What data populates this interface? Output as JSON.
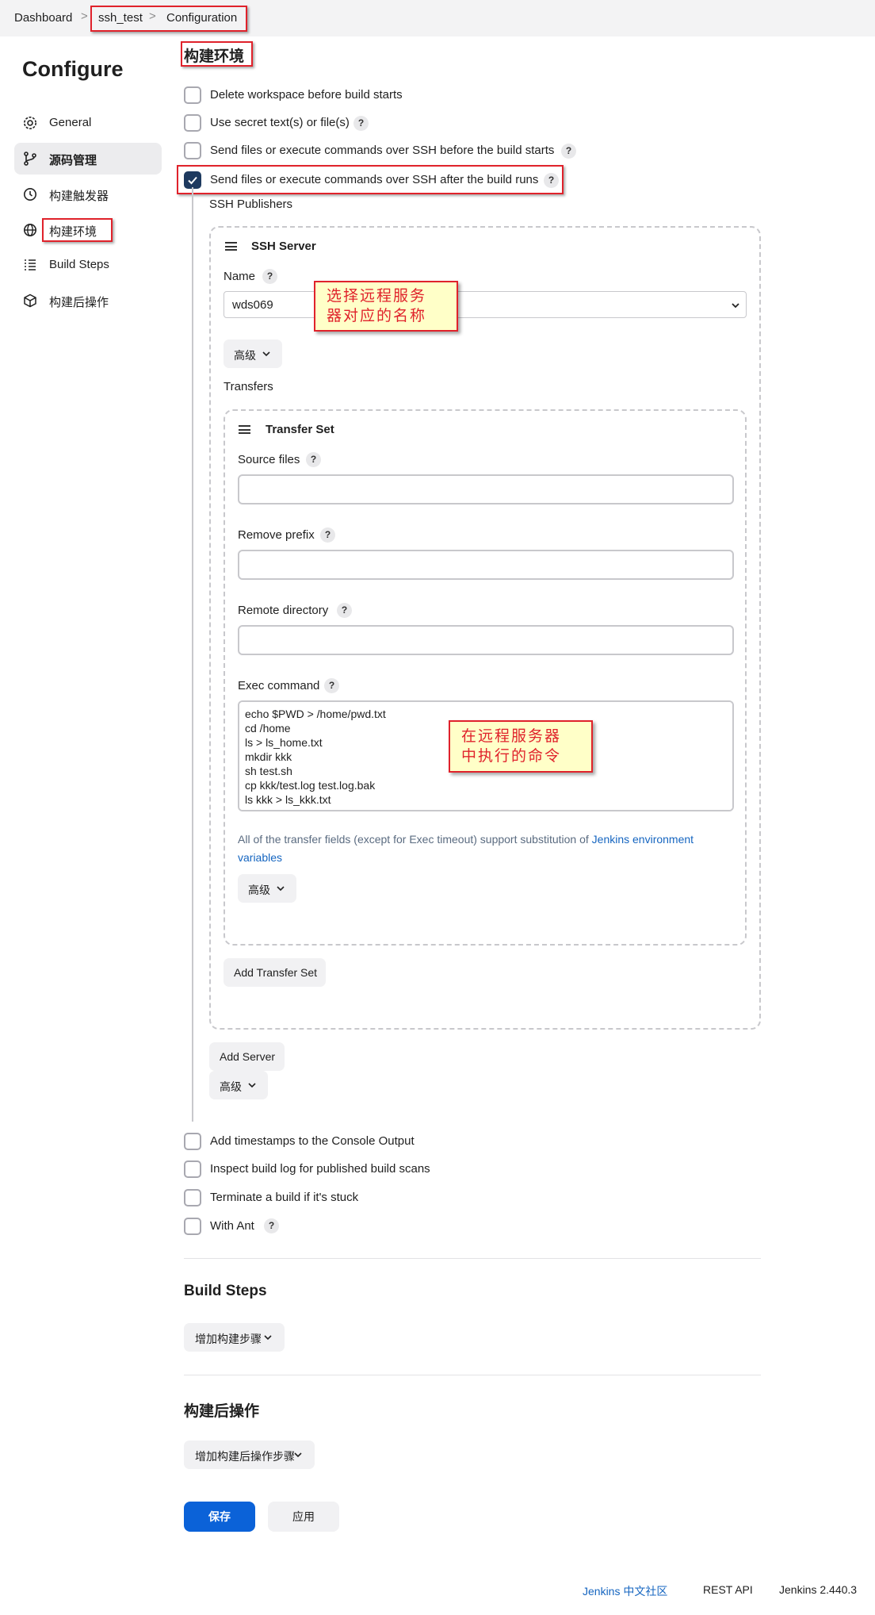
{
  "breadcrumb": {
    "items": [
      "Dashboard",
      "ssh_test",
      "Configuration"
    ],
    "separator": ">"
  },
  "sidebar": {
    "title": "Configure",
    "items": [
      {
        "label": "General",
        "icon": "gear-icon"
      },
      {
        "label": "源码管理",
        "icon": "branch-icon"
      },
      {
        "label": "构建触发器",
        "icon": "clock-icon"
      },
      {
        "label": "构建环境",
        "icon": "globe-icon"
      },
      {
        "label": "Build Steps",
        "icon": "list-icon"
      },
      {
        "label": "构建后操作",
        "icon": "cube-icon"
      }
    ]
  },
  "build_env": {
    "title": "构建环境",
    "options": [
      {
        "label": "Delete workspace before build starts",
        "checked": false
      },
      {
        "label": "Use secret text(s) or file(s)",
        "checked": false
      },
      {
        "label": "Send files or execute commands over SSH before the build starts",
        "checked": false
      },
      {
        "label": "Send files or execute commands over SSH after the build runs",
        "checked": true
      }
    ],
    "help": "?"
  },
  "ssh": {
    "publishers_label": "SSH Publishers",
    "server_title": "SSH Server",
    "name_label": "Name",
    "name_value": "wds069",
    "advanced": "高级",
    "transfers_label": "Transfers",
    "transfer_set_title": "Transfer Set",
    "source_files_label": "Source files",
    "remove_prefix_label": "Remove prefix",
    "remote_directory_label": "Remote directory",
    "exec_command_label": "Exec command",
    "exec_command_value": "echo $PWD > /home/pwd.txt\ncd /home\nls > ls_home.txt\nmkdir kkk\nsh test.sh\ncp kkk/test.log test.log.bak\nls kkk > ls_kkk.txt",
    "info_text": "All of the transfer fields (except for Exec timeout) support substitution of ",
    "info_link": "Jenkins environment variables",
    "add_transfer_set": "Add Transfer Set",
    "add_server": "Add Server"
  },
  "more_options": [
    {
      "label": "Add timestamps to the Console Output",
      "checked": false
    },
    {
      "label": "Inspect build log for published build scans",
      "checked": false
    },
    {
      "label": "Terminate a build if it's stuck",
      "checked": false
    },
    {
      "label": "With Ant",
      "checked": false
    }
  ],
  "build_steps": {
    "title": "Build Steps",
    "add_label": "增加构建步骤"
  },
  "post_build": {
    "title": "构建后操作",
    "add_label": "增加构建后操作步骤"
  },
  "actions": {
    "save": "保存",
    "apply": "应用"
  },
  "annotations": {
    "name_note": "选择远程服务\n器对应的名称",
    "cmd_note": "在远程服务器\n中执行的命令"
  },
  "footer": {
    "community": "Jenkins 中文社区",
    "rest_api": "REST API",
    "version": "Jenkins 2.440.3"
  },
  "colors": {
    "primary": "#0b62d8",
    "annotation_border": "#e0222b",
    "annotation_bg": "#ffffc8",
    "checkbox_checked": "#1e3a5f"
  }
}
